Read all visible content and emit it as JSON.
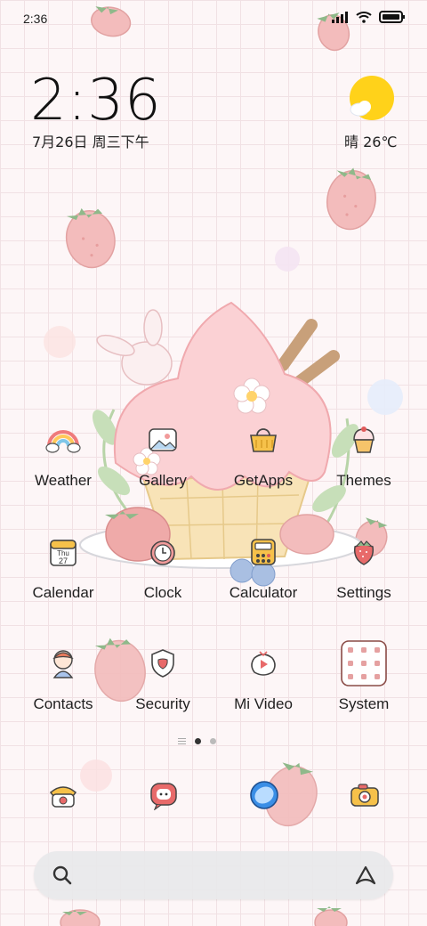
{
  "status_bar": {
    "time": "2:36"
  },
  "clock_widget": {
    "time": "2:36",
    "date": "7月26日 周三下午"
  },
  "weather_widget": {
    "text": "晴 26℃"
  },
  "apps": [
    {
      "label": "Weather",
      "icon": "rainbow-icon"
    },
    {
      "label": "Gallery",
      "icon": "photo-icon"
    },
    {
      "label": "GetApps",
      "icon": "shopping-basket-icon"
    },
    {
      "label": "Themes",
      "icon": "cupcake-icon"
    },
    {
      "label": "Calendar",
      "icon": "calendar-icon",
      "calendar_day": "Thu",
      "calendar_date": "27"
    },
    {
      "label": "Clock",
      "icon": "clock-icon"
    },
    {
      "label": "Calculator",
      "icon": "calculator-icon"
    },
    {
      "label": "Settings",
      "icon": "strawberry-icon"
    },
    {
      "label": "Contacts",
      "icon": "girl-avatar-icon"
    },
    {
      "label": "Security",
      "icon": "shield-icon"
    },
    {
      "label": "Mi Video",
      "icon": "video-play-icon"
    },
    {
      "label": "System",
      "icon": "folder-grid-icon"
    }
  ],
  "page_indicator": {
    "pages": 2,
    "active": 1
  },
  "dock": [
    {
      "icon": "telephone-icon"
    },
    {
      "icon": "message-bubble-icon"
    },
    {
      "icon": "browser-globe-icon"
    },
    {
      "icon": "camera-icon"
    }
  ],
  "colors": {
    "accent_pink": "#f4b8bd",
    "sun": "#ffd21a",
    "background": "#fdf6f7"
  }
}
